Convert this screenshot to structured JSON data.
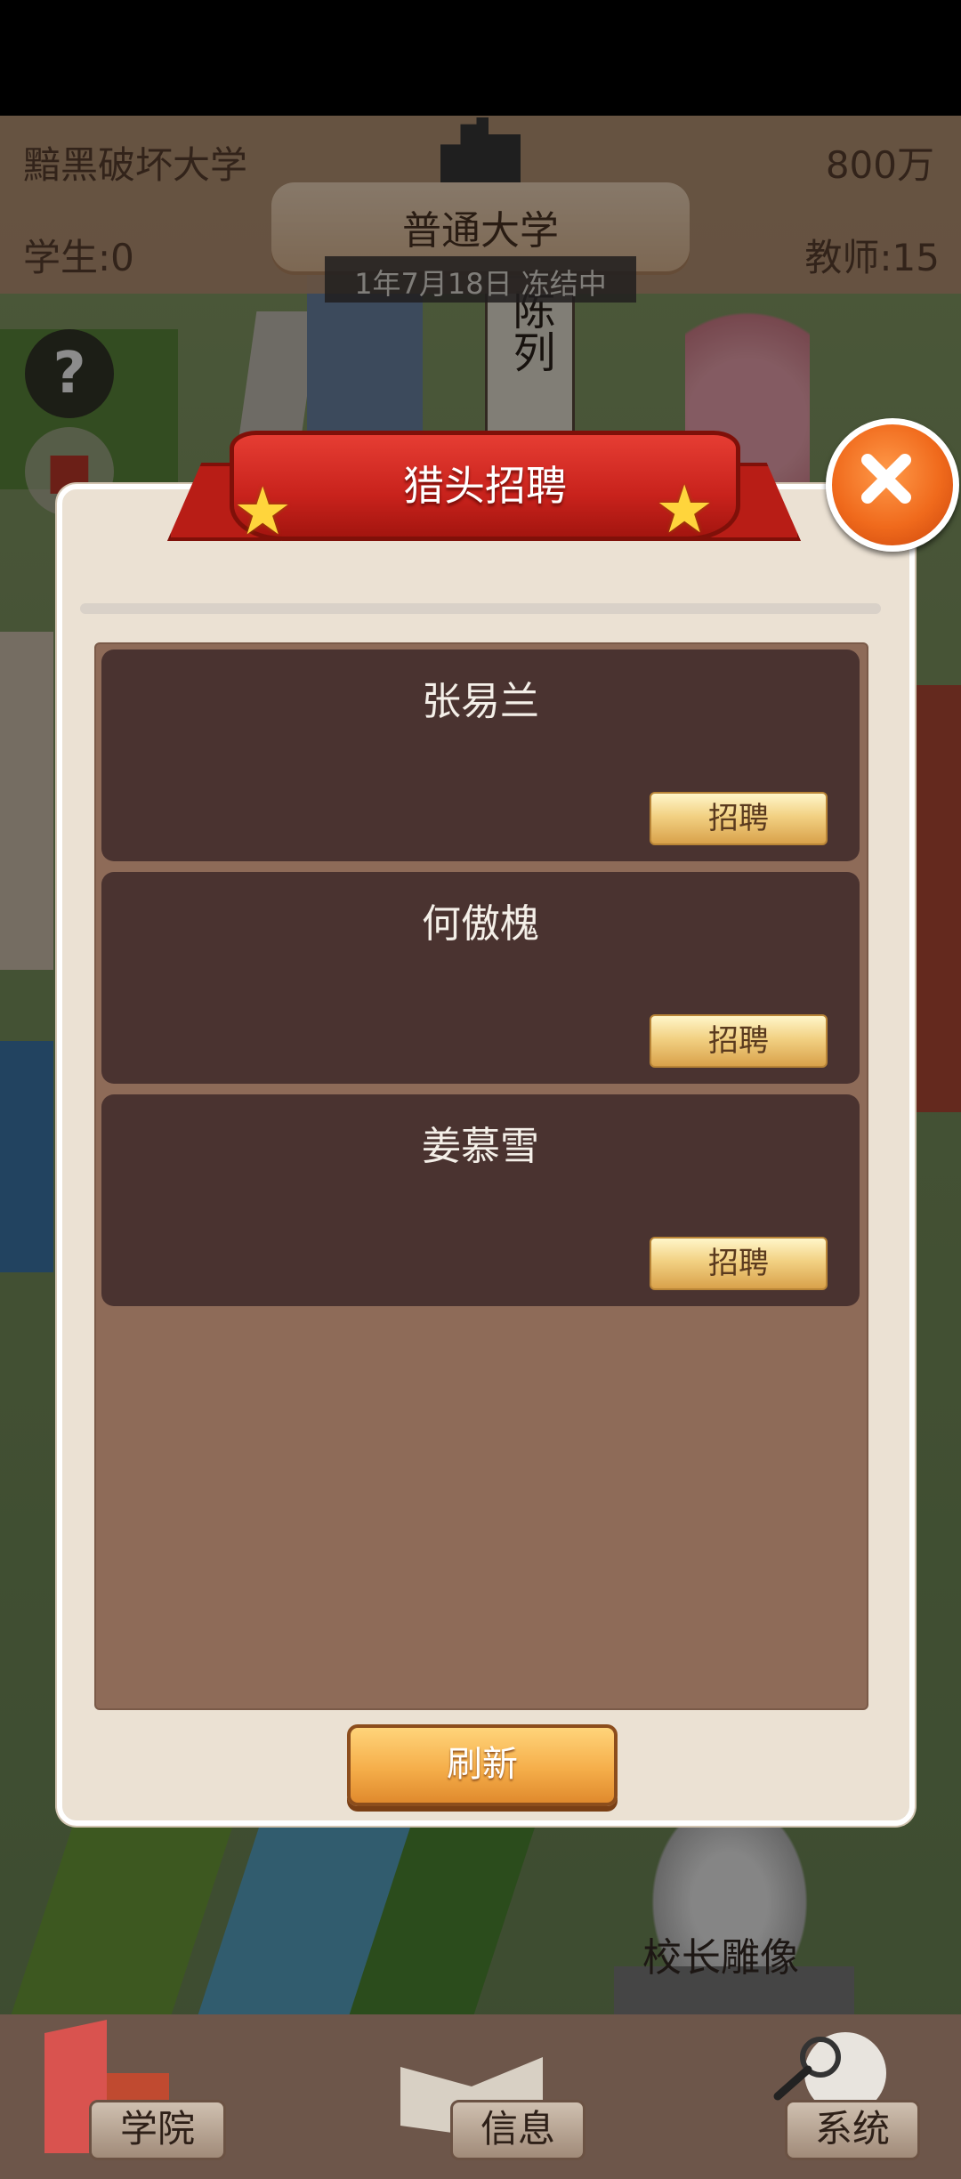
{
  "hud": {
    "university_name": "黯黑破坏大学",
    "money": "800万",
    "students": "学生:0",
    "teachers": "教师:15",
    "rank": "普通大学",
    "date_status": "1年7月18日 冻结中"
  },
  "scene": {
    "building_sign": "陈列",
    "statue_label": "校长雕像"
  },
  "dialog": {
    "title": "猎头招聘",
    "candidates": [
      {
        "name": "张易兰",
        "action": "招聘"
      },
      {
        "name": "何傲槐",
        "action": "招聘"
      },
      {
        "name": "姜慕雪",
        "action": "招聘"
      }
    ],
    "refresh_label": "刷新"
  },
  "bottom_tabs": [
    {
      "label": "学院",
      "icon": "building-icon"
    },
    {
      "label": "信息",
      "icon": "book-icon"
    },
    {
      "label": "系统",
      "icon": "magnifier-icon"
    }
  ],
  "colors": {
    "ribbon": "#c8221c",
    "card_bg": "#4a3330",
    "list_bg": "#8e6b58",
    "dialog_bg": "#ebe1d3",
    "close_button": "#f06a1c"
  }
}
